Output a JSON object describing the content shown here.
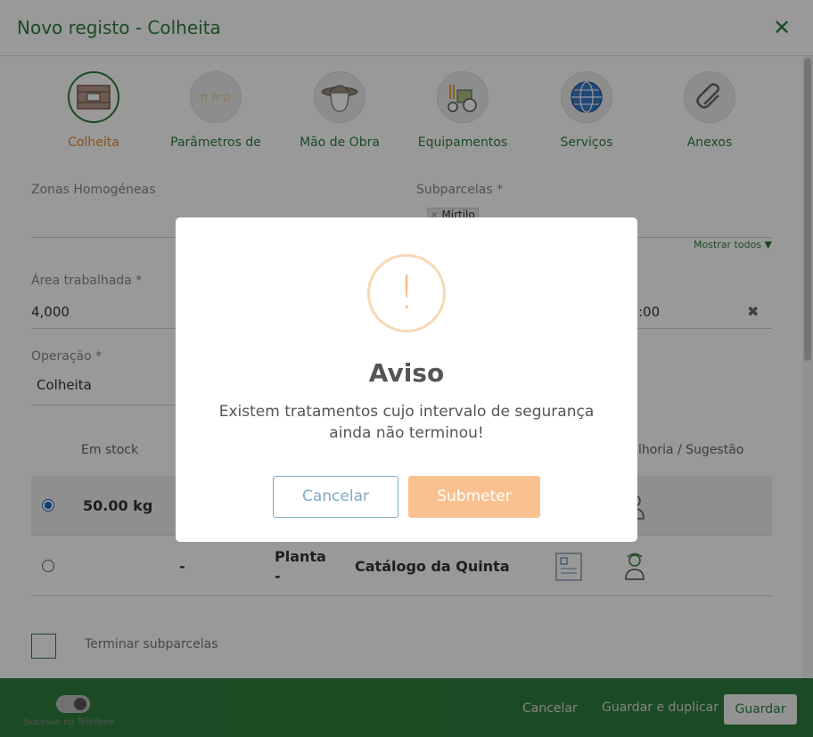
{
  "header": {
    "title": "Novo registo - Colheita",
    "close_icon": "close-icon"
  },
  "tabs": [
    {
      "label": "Colheita",
      "icon": "crate-icon",
      "active": true
    },
    {
      "label": "Parâmetros de",
      "icon": "stars-icon",
      "active": false
    },
    {
      "label": "Mão de Obra",
      "icon": "worker-hat-icon",
      "active": false
    },
    {
      "label": "Equipamentos",
      "icon": "tractor-icon",
      "active": false
    },
    {
      "label": "Serviços",
      "icon": "globe-icon",
      "active": false
    },
    {
      "label": "Anexos",
      "icon": "paperclip-icon",
      "active": false
    }
  ],
  "form": {
    "zonas_label": "Zonas Homogéneas",
    "subparcelas_label": "Subparcelas *",
    "subparcelas_chip": "Mirtilo",
    "subparcelas_chip_remove": "×",
    "show_all": "Mostrar todos ▼",
    "area_label": "Área trabalhada *",
    "area_value": "4,000",
    "time_value": ":00",
    "clear_icon": "✖",
    "operacao_label": "Operação *",
    "operacao_value": "Colheita"
  },
  "table": {
    "headers": {
      "stock": "Em stock",
      "suggestion": "lhoria / Sugestão"
    },
    "rows": [
      {
        "selected": true,
        "stock": "50.00 kg",
        "col2": "",
        "col3": "",
        "col4": ""
      },
      {
        "selected": false,
        "stock": "",
        "col2": "-",
        "col3_line1": "Planta",
        "col3_line2": "-",
        "col4": "Catálogo da Quinta"
      }
    ]
  },
  "terminate": {
    "label": "Terminar subparcelas"
  },
  "footer": {
    "toggle_label": "Sucesso no Telefone",
    "cancel": "Cancelar",
    "save_duplicate": "Guardar e duplicar",
    "save": "Guardar"
  },
  "modal": {
    "icon": "warning-icon",
    "glyph": "!",
    "title": "Aviso",
    "message": "Existem tratamentos cujo intervalo de segurança ainda não terminou!",
    "cancel": "Cancelar",
    "submit": "Submeter"
  },
  "colors": {
    "brand": "#2e7d3c",
    "active_tab": "#e08a2c",
    "warning": "#f8bb86",
    "submit": "#f8c18f"
  }
}
